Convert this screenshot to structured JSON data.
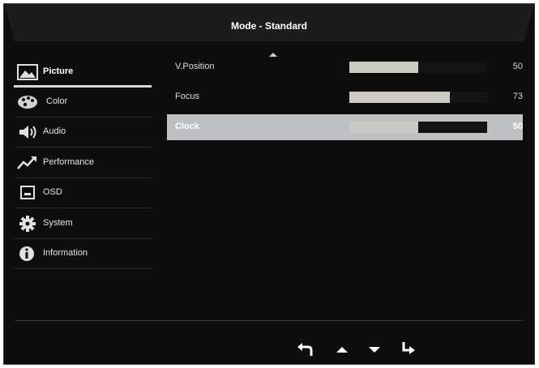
{
  "header": {
    "title": "Mode - Standard"
  },
  "sidebar": {
    "items": [
      {
        "label": "Picture",
        "icon": "picture-icon",
        "active": true
      },
      {
        "label": "Color",
        "icon": "palette-icon",
        "active": false
      },
      {
        "label": "Audio",
        "icon": "speaker-icon",
        "active": false
      },
      {
        "label": "Performance",
        "icon": "trend-icon",
        "active": false
      },
      {
        "label": "OSD",
        "icon": "osd-window-icon",
        "active": false
      },
      {
        "label": "System",
        "icon": "gear-icon",
        "active": false
      },
      {
        "label": "Information",
        "icon": "info-icon",
        "active": false
      }
    ]
  },
  "settings": {
    "rows": [
      {
        "name": "V.Position",
        "value": "50",
        "level": 50,
        "selected": false
      },
      {
        "name": "Focus",
        "value": "73",
        "level": 73,
        "selected": false
      },
      {
        "name": "Clock",
        "value": "50",
        "level": 50,
        "selected": true
      }
    ]
  },
  "navigation": {
    "buttons": [
      "back-icon",
      "up-arrow-icon",
      "down-arrow-icon",
      "enter-icon"
    ]
  },
  "colors": {
    "background": "#0d0d0d",
    "title_bar": "#1c1c1c",
    "selected_row": "#bfc0c2",
    "slider_fill": "#cbcbc2"
  }
}
